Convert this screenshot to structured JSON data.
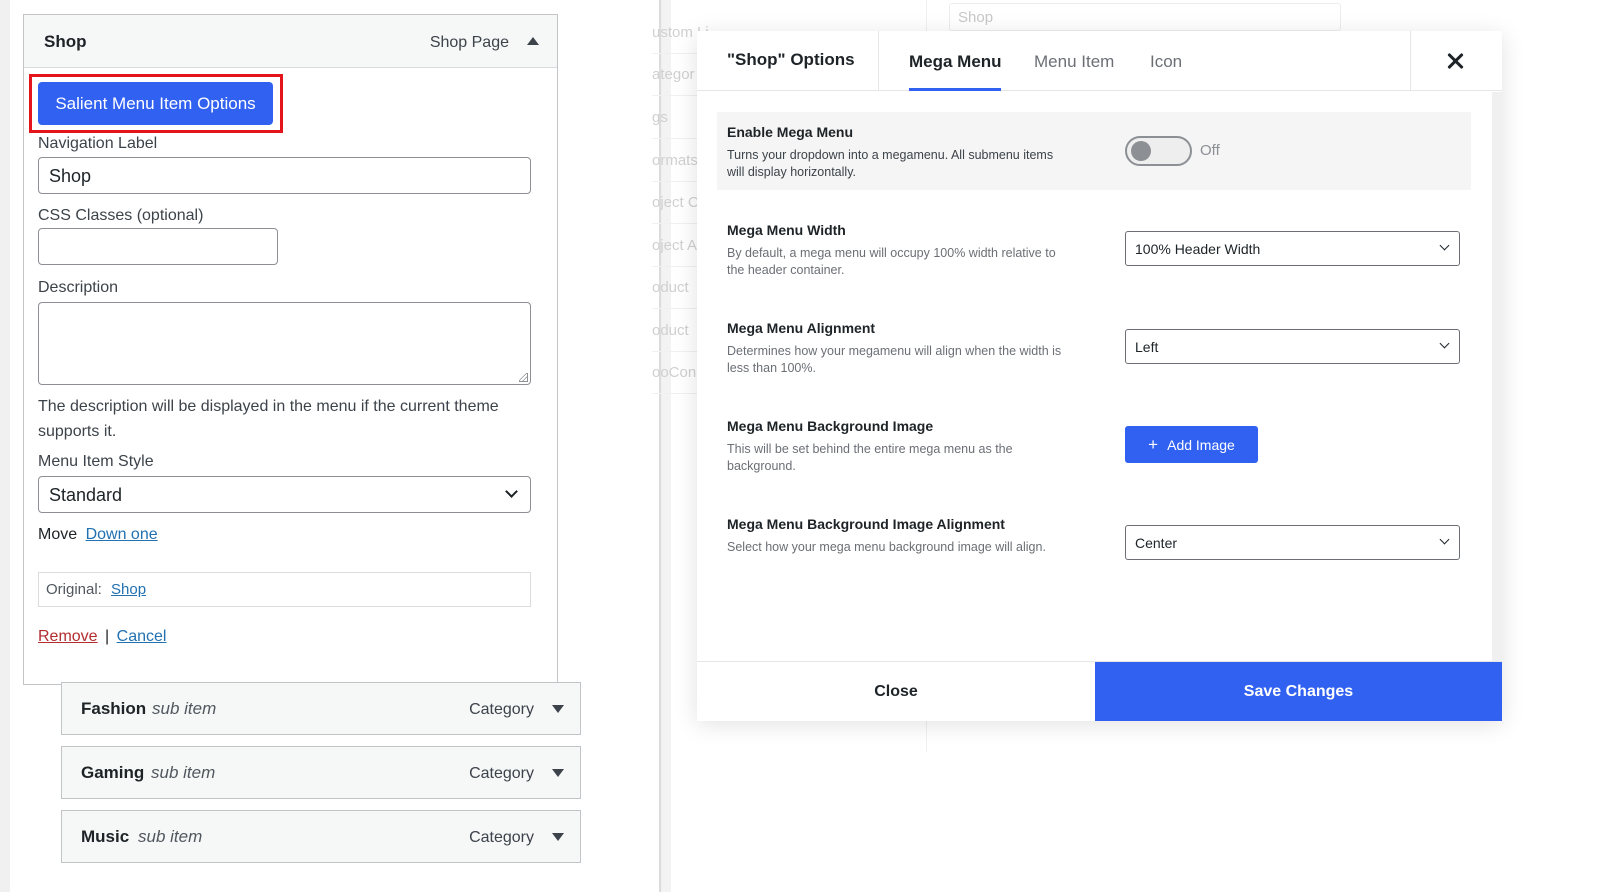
{
  "menu_item": {
    "title": "Shop",
    "type": "Shop Page",
    "salient_button": "Salient Menu Item Options",
    "nav_label_label": "Navigation Label",
    "nav_label_value": "Shop",
    "css_classes_label": "CSS Classes (optional)",
    "css_classes_value": "",
    "description_label": "Description",
    "description_help": "The description will be displayed in the menu if the current theme supports it.",
    "style_label": "Menu Item Style",
    "style_value": "Standard",
    "move_label": "Move",
    "move_link": "Down one",
    "original_label": "Original:",
    "original_link": "Shop",
    "remove_link": "Remove",
    "separator": "|",
    "cancel_link": "Cancel"
  },
  "sub_items": [
    {
      "title": "Fashion",
      "tag": "sub item",
      "type": "Category"
    },
    {
      "title": "Gaming",
      "tag": "sub item",
      "type": "Category"
    },
    {
      "title": "Music",
      "tag": "sub item",
      "type": "Category"
    }
  ],
  "background": {
    "sidebar_items": [
      "ustom Li",
      "ategor",
      "gs",
      "ormats",
      "oject C",
      "oject A",
      "oduct",
      "oduct",
      "ooCon"
    ],
    "search_placeholder": "Shop"
  },
  "modal": {
    "title": "\"Shop\" Options",
    "tabs": [
      "Mega Menu",
      "Menu Item",
      "Icon"
    ],
    "active_tab": "Mega Menu",
    "options": [
      {
        "title": "Enable Mega Menu",
        "desc": "Turns your dropdown into a megamenu. All submenu items will display horizontally.",
        "control": "toggle",
        "state": "Off"
      },
      {
        "title": "Mega Menu Width",
        "desc": "By default, a mega menu will occupy 100% width relative to the header container.",
        "control": "select",
        "value": "100% Header Width"
      },
      {
        "title": "Mega Menu Alignment",
        "desc": "Determines how your megamenu will align when the width is less than 100%.",
        "control": "select",
        "value": "Left"
      },
      {
        "title": "Mega Menu Background Image",
        "desc": "This will be set behind the entire mega menu as the background.",
        "control": "button",
        "value": "Add Image"
      },
      {
        "title": "Mega Menu Background Image Alignment",
        "desc": "Select how your mega menu background image will align.",
        "control": "select",
        "value": "Center"
      }
    ],
    "close_label": "Close",
    "save_label": "Save Changes"
  },
  "colors": {
    "accent": "#3161f0",
    "highlight": "#e3141a",
    "link": "#2271b1",
    "remove": "#b32d2e"
  }
}
